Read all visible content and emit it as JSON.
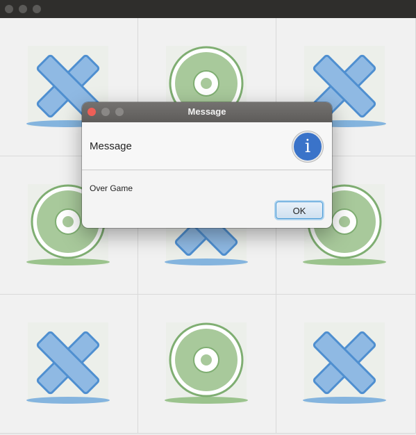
{
  "window": {
    "titlebar_buttons": [
      "close",
      "minimize",
      "zoom"
    ]
  },
  "board": {
    "cells": [
      "X",
      "O",
      "X",
      "O",
      "X",
      "O",
      "X",
      "O",
      "X"
    ],
    "colors": {
      "x_fill": "#8fb9e3",
      "x_stroke": "#4f8fd0",
      "o_fill": "#a8c99b",
      "o_stroke": "#7fae72",
      "shadow_x": "#6aa5db",
      "shadow_o": "#8dbb7d"
    }
  },
  "dialog": {
    "title": "Message",
    "header": "Message",
    "content": "Over Game",
    "ok_label": "OK",
    "icon": "info-icon",
    "icon_glyph": "i",
    "traffic_colors": {
      "close": "#ed5f57",
      "minimize": "#8a8886",
      "zoom": "#8a8886"
    }
  }
}
